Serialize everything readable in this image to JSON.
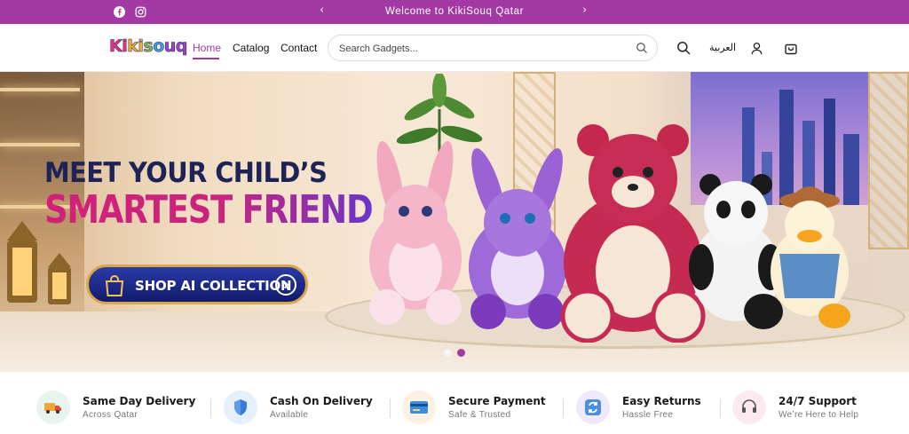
{
  "announcement": {
    "text": "Welcome to KikiSouq Qatar",
    "prev_arrow": "‹",
    "next_arrow": "›",
    "social_icons": [
      "facebook-icon",
      "instagram-icon"
    ]
  },
  "header": {
    "logo_text": "Kikisouq",
    "nav": [
      {
        "label": "Home",
        "active": true
      },
      {
        "label": "Catalog",
        "active": false
      },
      {
        "label": "Contact",
        "active": false
      }
    ],
    "search": {
      "placeholder": "Search Gadgets...",
      "value": ""
    },
    "language_label": "العربية",
    "icons": [
      "search-icon",
      "user-icon",
      "cart-icon"
    ]
  },
  "hero": {
    "headline_line1": "MEET YOUR CHILD’S",
    "headline_line2": "SMARTEST FRIEND",
    "cta_label": "SHOP AI COLLECTION",
    "slides": 2,
    "active_slide": 2
  },
  "features": [
    {
      "title": "Same Day Delivery",
      "subtitle": "Across Qatar",
      "icon": "delivery-truck-icon",
      "bg": "#e7f5ee"
    },
    {
      "title": "Cash On Delivery",
      "subtitle": "Available",
      "icon": "shield-icon",
      "bg": "#e6f0fb"
    },
    {
      "title": "Secure Payment",
      "subtitle": "Safe & Trusted",
      "icon": "credit-card-icon",
      "bg": "#fdf2e2"
    },
    {
      "title": "Easy Returns",
      "subtitle": "Hassle Free",
      "icon": "returns-icon",
      "bg": "#efe9fb"
    },
    {
      "title": "24/7 Support",
      "subtitle": "We’re Here to Help",
      "icon": "headset-icon",
      "bg": "#fdeaf0"
    }
  ],
  "colors": {
    "brand": "#a33aa3",
    "headline_navy": "#1d2357",
    "headline_pink": "#d2207a",
    "cta_blue": "#1a2690",
    "cta_gold": "#d8a84a"
  }
}
